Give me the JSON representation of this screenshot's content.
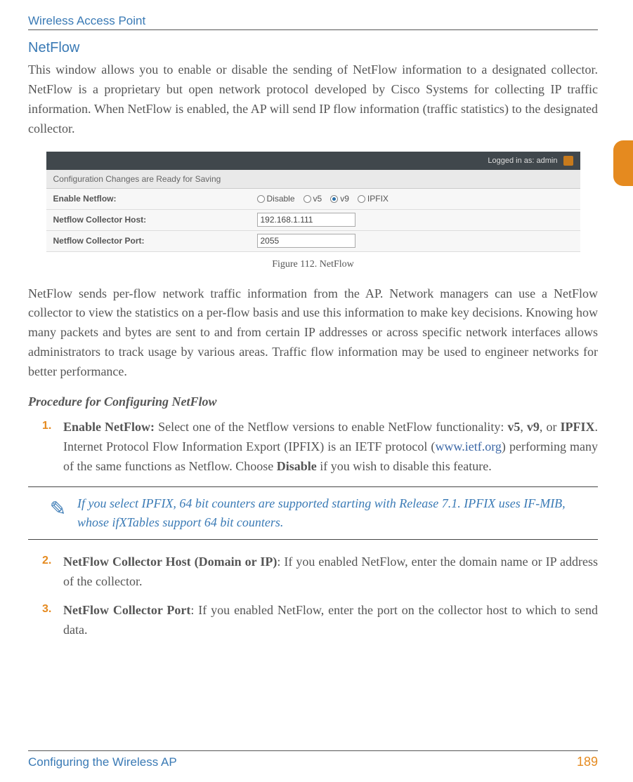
{
  "header": {
    "title": "Wireless Access Point"
  },
  "section": {
    "heading": "NetFlow"
  },
  "paras": {
    "p1": "This window allows you to enable or disable the sending of NetFlow information to a designated collector. NetFlow is a proprietary but open network protocol developed by Cisco Systems for collecting IP traffic information. When NetFlow is enabled, the AP will send IP flow information (traffic statistics) to the designated collector.",
    "p2": "NetFlow sends per-flow network traffic information from the AP. Network managers can use a NetFlow collector to view the statistics on a per-flow basis and use this information to make key decisions. Knowing how many packets and bytes are sent to and from certain IP addresses or across specific network interfaces allows administrators to track usage by various areas. Traffic flow information may be used to engineer networks for better performance."
  },
  "screenshot": {
    "logged_in": "Logged in as: admin",
    "notice": "Configuration Changes are Ready for Saving",
    "row1_label": "Enable Netflow:",
    "row2_label": "Netflow Collector Host:",
    "row3_label": "Netflow Collector Port:",
    "opt_disable": "Disable",
    "opt_v5": "v5",
    "opt_v9": "v9",
    "opt_ipfix": "IPFIX",
    "host_value": "192.168.1.111",
    "port_value": "2055"
  },
  "figure_caption": "Figure 112. NetFlow",
  "procedure_heading": "Procedure for Configuring NetFlow",
  "steps": {
    "s1num": "1.",
    "s1a": "Enable NetFlow:",
    "s1b": " Select one of the Netflow versions to enable NetFlow functionality: ",
    "s1c": "v5",
    "s1d": ", ",
    "s1e": "v9",
    "s1f": ", or ",
    "s1g": "IPFIX",
    "s1h": ". Internet Protocol Flow Information Export (IPFIX) is an IETF protocol (",
    "s1link": "www.ietf.org",
    "s1i": ") performing many of the same functions as Netflow. Choose ",
    "s1j": "Disable",
    "s1k": " if you wish to disable this feature.",
    "s2num": "2.",
    "s2a": "NetFlow Collector Host (Domain or IP)",
    "s2b": ": If you enabled NetFlow, enter the domain name or IP address of the collector.",
    "s3num": "3.",
    "s3a": "NetFlow Collector Port",
    "s3b": ": If you enabled NetFlow, enter the port on the collector host to which to send data."
  },
  "note": "If you select IPFIX, 64 bit counters are supported starting with Release 7.1. IPFIX uses IF-MIB, whose ifXTables support 64 bit counters.",
  "footer": {
    "left": "Configuring the Wireless AP",
    "right": "189"
  }
}
